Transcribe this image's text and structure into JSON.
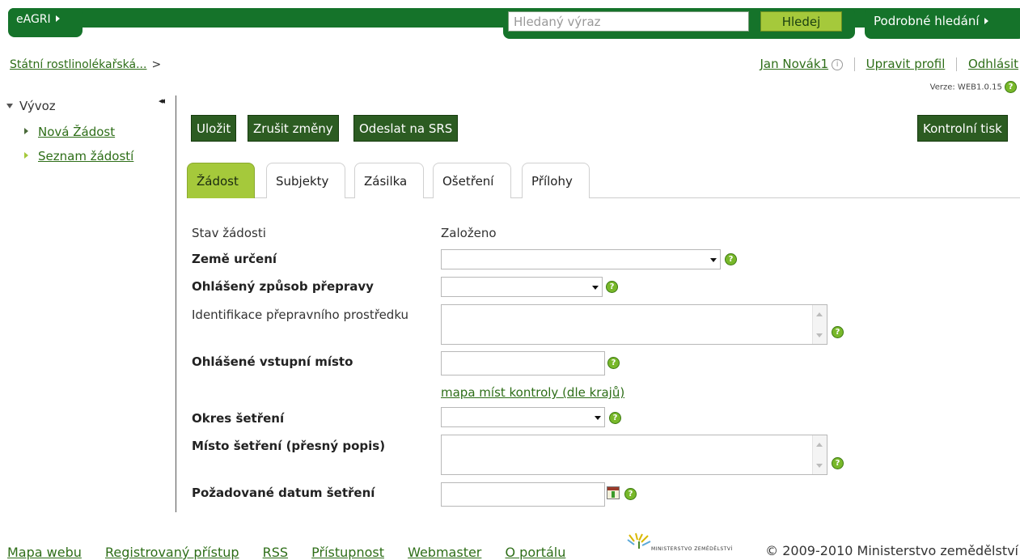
{
  "header": {
    "eagri_label": "eAGRI",
    "search_placeholder": "Hledaný výraz",
    "search_button": "Hledej",
    "advanced_search": "Podrobné hledání"
  },
  "breadcrumb": {
    "item": "Státní rostlinolékařská...",
    "sep": ">"
  },
  "user": {
    "name": "Jan Novák1",
    "edit_profile": "Upravit profil",
    "logout": "Odhlásit",
    "version": "Verze: WEB1.0.15"
  },
  "sidebar": {
    "collapse": "◂◂",
    "section": "Vývoz",
    "items": [
      "Nová Žádost",
      "Seznam žádostí"
    ]
  },
  "toolbar": {
    "save": "Uložit",
    "cancel": "Zrušit změny",
    "send": "Odeslat na SRS",
    "print": "Kontrolní tisk"
  },
  "tabs": [
    "Žádost",
    "Subjekty",
    "Zásilka",
    "Ošetření",
    "Přílohy"
  ],
  "form": {
    "status_label": "Stav žádosti",
    "status_value": "Založeno",
    "country_label": "Země určení",
    "transport_label": "Ohlášený způsob přepravy",
    "vehicle_label": "Identifikace přepravního prostředku",
    "entry_label": "Ohlášené vstupní místo",
    "map_link": "mapa míst kontroly (dle krajů)",
    "district_label": "Okres šetření",
    "place_label": "Místo šetření (přesný popis)",
    "date_label": "Požadované datum šetření"
  },
  "footer": {
    "links": [
      "Mapa webu",
      "Registrovaný přístup",
      "RSS",
      "Přístupnost",
      "Webmaster",
      "O portálu"
    ],
    "ministry_logo_text": "MINISTERSTVO ZEMĚDĚLSTVÍ",
    "copyright": "© 2009-2010 Ministerstvo zemědělství"
  },
  "colors": {
    "header_green": "#15732a",
    "button_dark": "#2c5c22",
    "active_tab": "#a5c93b",
    "link": "#2e6e18"
  },
  "icons": {
    "help": "help-icon",
    "info": "info-icon",
    "calendar": "calendar-icon"
  }
}
